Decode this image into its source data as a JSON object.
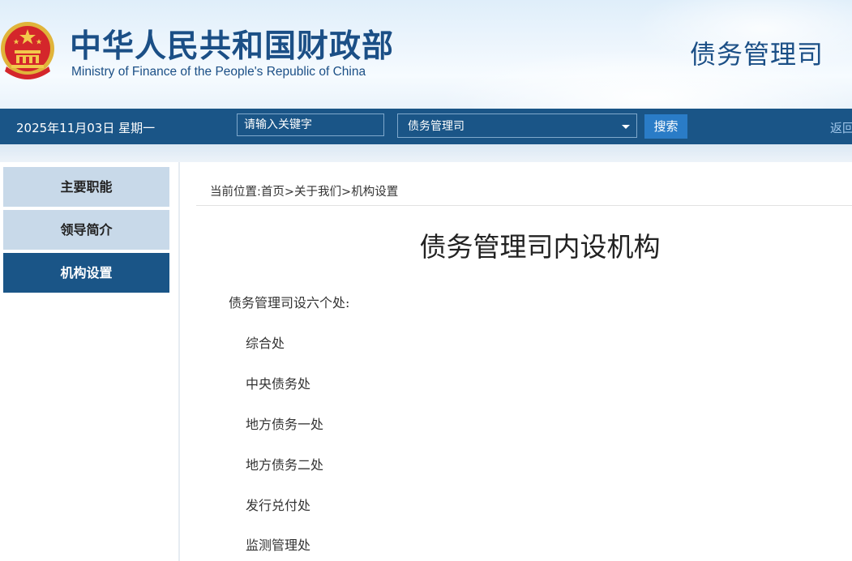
{
  "header": {
    "title_cn": "中华人民共和国财政部",
    "title_en": "Ministry of Finance of the People's Republic of China",
    "department": "债务管理司"
  },
  "nav": {
    "date": "2025年11月03日  星期一",
    "search_placeholder": "请输入关键字",
    "scope_selected": "债务管理司",
    "search_button": "搜索",
    "back_link": "返回"
  },
  "sidebar": {
    "items": [
      {
        "label": "主要职能"
      },
      {
        "label": "领导简介"
      },
      {
        "label": "机构设置",
        "active": true
      }
    ]
  },
  "breadcrumb": {
    "prefix": "当前位置:",
    "items": [
      "首页",
      "关于我们",
      "机构设置"
    ],
    "separator": ">"
  },
  "article": {
    "title": "债务管理司内设机构",
    "intro": "债务管理司设六个处:",
    "units": [
      "综合处",
      "中央债务处",
      "地方债务一处",
      "地方债务二处",
      "发行兑付处",
      "监测管理处"
    ]
  },
  "colors": {
    "brand_blue": "#1a5587",
    "sidebar_inactive": "#c8d9e9",
    "search_button": "#2a7cc7"
  }
}
